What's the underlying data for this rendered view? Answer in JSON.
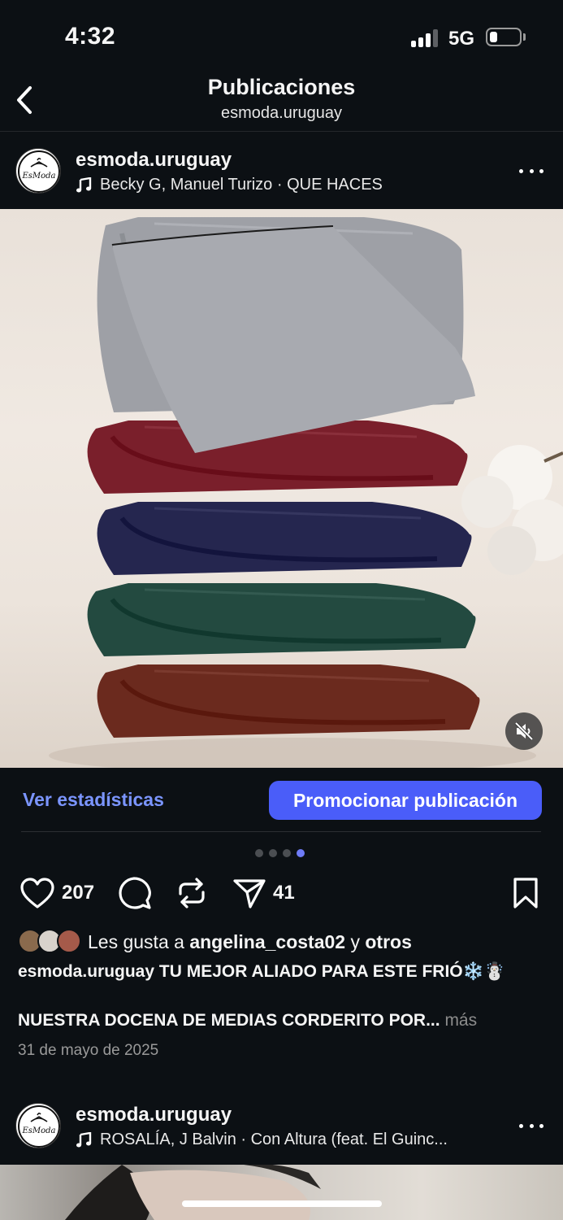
{
  "status_bar": {
    "time": "4:32",
    "network": "5G"
  },
  "header": {
    "title": "Publicaciones",
    "subtitle": "esmoda.uruguay"
  },
  "post": {
    "username": "esmoda.uruguay",
    "audio": "Becky G, Manuel Turizo · QUE HACES",
    "avatar_text": "EsModa",
    "stats_link": "Ver estadísticas",
    "promote_button": "Promocionar publicación",
    "carousel": {
      "count": 4,
      "active_index": 3
    },
    "likes_count": "207",
    "shares_count": "41",
    "liked_by_prefix": "Les gusta a ",
    "liked_by_user": "angelina_costa02",
    "liked_by_and": " y ",
    "liked_by_others": "otros",
    "caption_user": "esmoda.uruguay",
    "caption_line1": " TU MEJOR ALIADO PARA ESTE FRIÓ❄️☃️",
    "caption_line2": "NUESTRA DOCENA DE MEDIAS CORDERITO POR...",
    "more_label": " más",
    "date": "31 de mayo de 2025",
    "towel_colors": [
      "#6b2a1e",
      "#234a40",
      "#25264f",
      "#7a1f2b",
      "#9ea0a6"
    ]
  },
  "next_post": {
    "username": "esmoda.uruguay",
    "audio": "ROSALÍA, J Balvin · Con Altura (feat. El Guinc...",
    "avatar_text": "EsModa"
  },
  "colors": {
    "background": "#0c1014",
    "accent": "#4a5df9",
    "link": "#7b95ff"
  },
  "icons": [
    "back-chevron-icon",
    "music-note-icon",
    "more-dots-icon",
    "mute-icon",
    "heart-icon",
    "comment-icon",
    "repost-icon",
    "share-icon",
    "bookmark-icon"
  ]
}
